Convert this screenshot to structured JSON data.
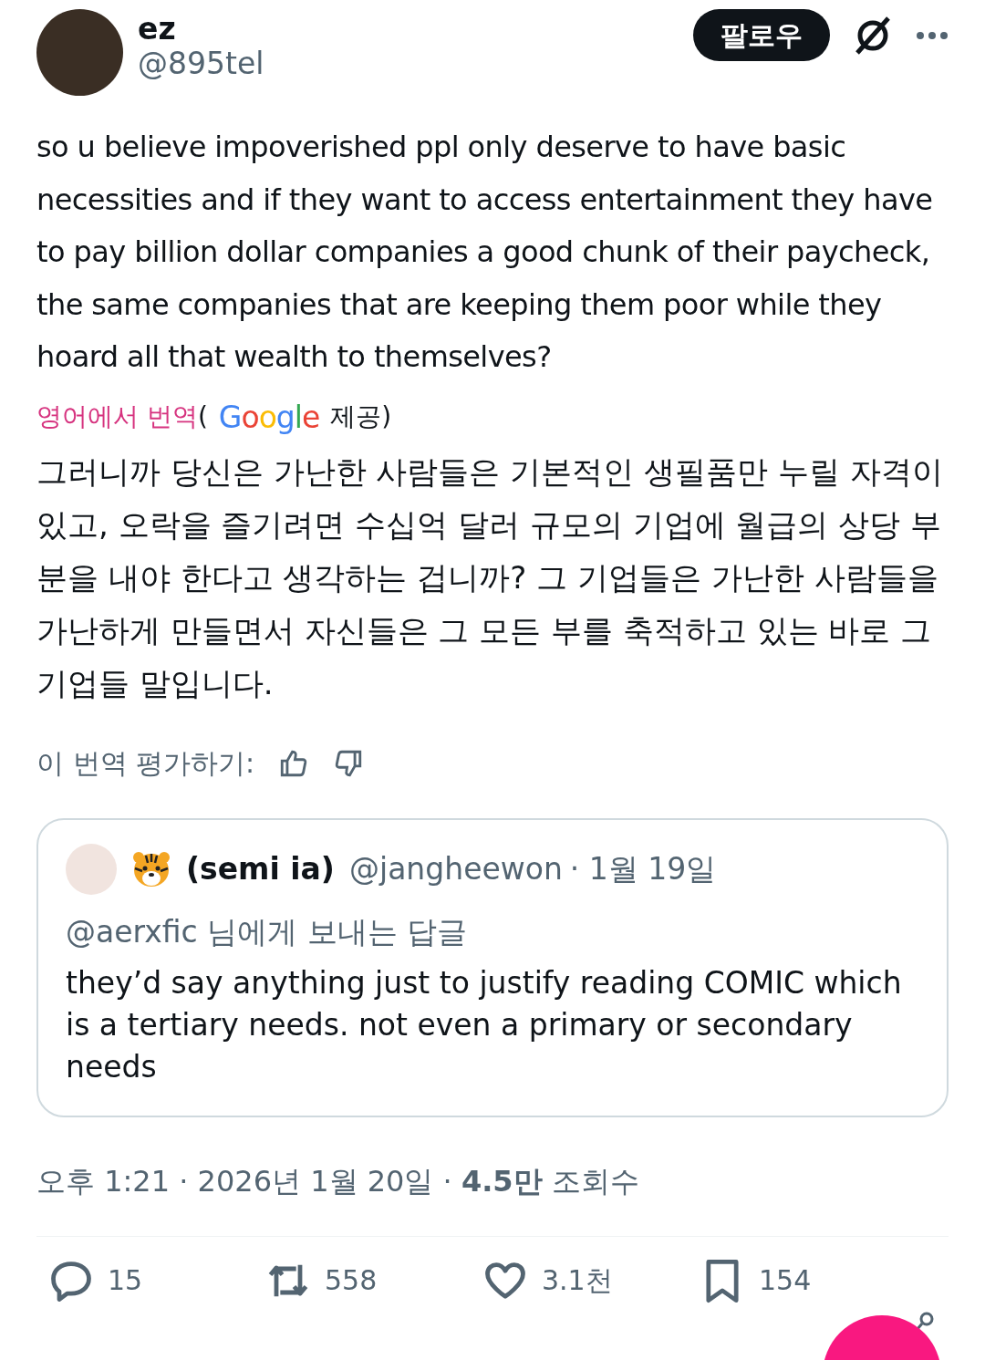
{
  "author": {
    "name": "ez",
    "handle": "@895tel"
  },
  "follow_button": "팔로우",
  "text": "so u believe impoverished ppl only deserve to have basic necessities and if they want to access entertainment they have to pay billion dollar companies a good chunk of their paycheck, the same companies that are keeping them poor while they hoard all that wealth to themselves?",
  "translation": {
    "source": "영어에서 번역",
    "open_paren": "(",
    "provider": "Google",
    "provided": "제공)",
    "text": "그러니까 당신은 가난한 사람들은 기본적인 생필품만 누릴 자격이 있고, 오락을 즐기려면 수십억 달러 규모의 기업에 월급의 상당 부분을 내야 한다고 생각하는 겁니까? 그 기업들은 가난한 사람들을 가난하게 만들면서 자신들은 그 모든 부를 축적하고 있는 바로 그 기업들 말입니다.",
    "rate_label": "이 번역 평가하기:"
  },
  "quote": {
    "name": "(semi ia)",
    "handle": "@jangheewon",
    "date": "· 1월 19일",
    "reply_to": "@aerxfic 님에게 보내는 답글",
    "text": "they’d say anything just to justify reading COMIC which is a tertiary needs. not even a primary or secondary needs"
  },
  "meta": "오후 1:21 · 2026년 1월 20일 · **4.5만** 조회수",
  "actions": [
    {
      "kind": "reply",
      "count": "15"
    },
    {
      "kind": "repost",
      "count": "558"
    },
    {
      "kind": "like",
      "count": "3.1천"
    },
    {
      "kind": "bookmark",
      "count": "154"
    }
  ]
}
